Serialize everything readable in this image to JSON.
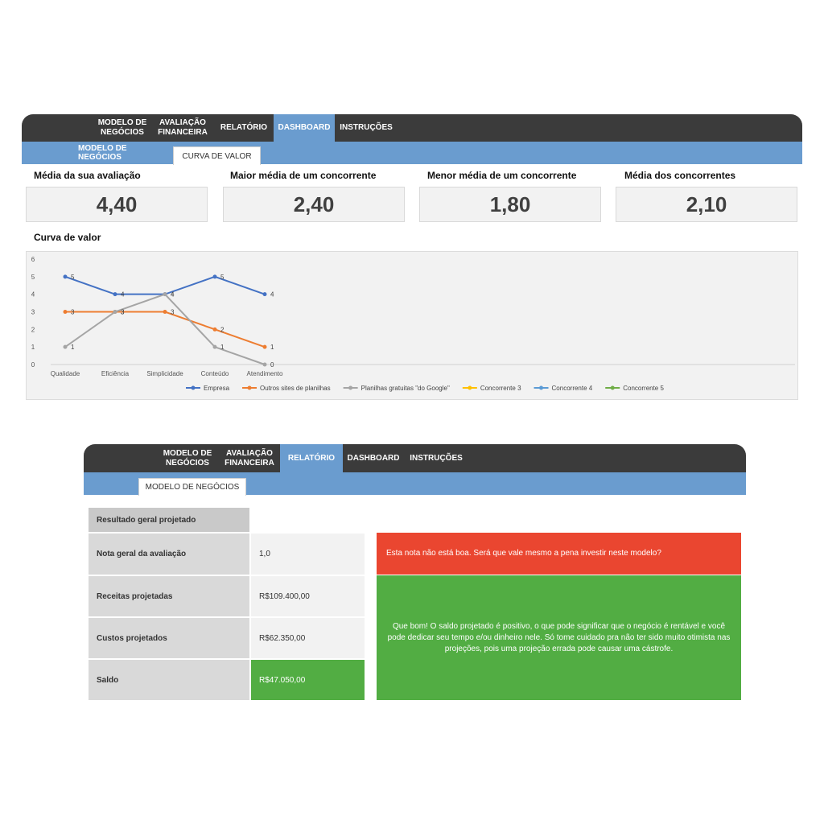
{
  "top_panel": {
    "nav": [
      {
        "label_1": "MODELO DE",
        "label_2": "NEGÓCIOS"
      },
      {
        "label_1": "AVALIAÇÃO",
        "label_2": "FINANCEIRA"
      },
      {
        "label": "RELATÓRIO"
      },
      {
        "label": "DASHBOARD"
      },
      {
        "label": "INSTRUÇÕES"
      }
    ],
    "active_tab": "DASHBOARD",
    "subtabs": [
      "MODELO DE NEGÓCIOS",
      "CURVA DE VALOR"
    ],
    "selected_subtab": "CURVA DE VALOR",
    "kpis": [
      {
        "label": "Média da sua avaliação",
        "value": "4,40"
      },
      {
        "label": "Maior média de um concorrente",
        "value": "2,40"
      },
      {
        "label": "Menor média de um concorrente",
        "value": "1,80"
      },
      {
        "label": "Média dos concorrentes",
        "value": "2,10"
      }
    ],
    "chart_title": "Curva de valor"
  },
  "chart_data": {
    "type": "line",
    "categories": [
      "Qualidade",
      "Eficiência",
      "Simplicidade",
      "Conteúdo",
      "Atendimento"
    ],
    "ylim": [
      0,
      6
    ],
    "yticks": [
      0,
      1,
      2,
      3,
      4,
      5,
      6
    ],
    "grid": false,
    "legend_position": "bottom",
    "series": [
      {
        "name": "Empresa",
        "color": "#4472c4",
        "values": [
          5,
          4,
          4,
          5,
          4
        ],
        "labels": [
          "5",
          "4",
          "4",
          "5",
          "4"
        ]
      },
      {
        "name": "Outros sites de planilhas",
        "color": "#ed7d31",
        "values": [
          3,
          3,
          3,
          2,
          1
        ],
        "labels": [
          "3",
          "3",
          "3",
          "2",
          "1"
        ]
      },
      {
        "name": "Planilhas gratuitas \"do Google\"",
        "color": "#a5a5a5",
        "values": [
          1,
          3,
          4,
          1,
          0
        ],
        "labels": [
          "1",
          "3",
          "4",
          "1",
          "0"
        ]
      },
      {
        "name": "Concorrente 3",
        "color": "#ffc000",
        "values": []
      },
      {
        "name": "Concorrente 4",
        "color": "#5b9bd5",
        "values": []
      },
      {
        "name": "Concorrente 5",
        "color": "#70ad47",
        "values": []
      }
    ]
  },
  "bottom_panel": {
    "nav": [
      {
        "label_1": "MODELO DE",
        "label_2": "NEGÓCIOS"
      },
      {
        "label_1": "AVALIAÇÃO",
        "label_2": "FINANCEIRA"
      },
      {
        "label": "RELATÓRIO"
      },
      {
        "label": "DASHBOARD"
      },
      {
        "label": "INSTRUÇÕES"
      }
    ],
    "active_tab": "RELATÓRIO",
    "subtab": "MODELO DE NEGÓCIOS",
    "table_header": "Resultado geral projetado",
    "rows": [
      {
        "label": "Nota geral da avaliação",
        "value": "1,0"
      },
      {
        "label": "Receitas projetadas",
        "value": "R$109.400,00"
      },
      {
        "label": "Custos projetados",
        "value": "R$62.350,00"
      },
      {
        "label": "Saldo",
        "value": "R$47.050,00"
      }
    ],
    "message_red": "Esta nota não está boa. Será que vale mesmo a pena investir neste modelo?",
    "message_green": "Que bom! O saldo projetado é positivo, o que pode significar que o negócio é rentável e você pode dedicar seu tempo e/ou dinheiro nele. Só tome cuidado pra não ter sido muito otimista nas projeções, pois uma projeção errada pode causar uma cástrofe.",
    "colors": {
      "red": "#ea4630",
      "green": "#52ad43",
      "tab_blue": "#6a9ccf",
      "bar_dark": "#3b3b3b"
    }
  }
}
